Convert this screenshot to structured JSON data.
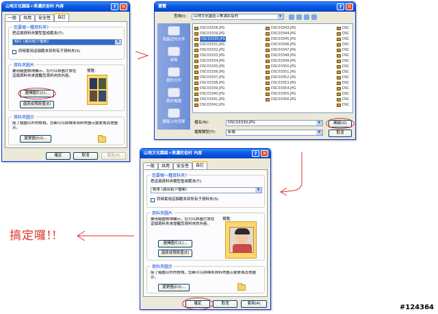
{
  "dialog1": {
    "title": "山地文化園區+美濃民俗村 內容",
    "tabs": [
      "一般",
      "共用",
      "安全性",
      "自訂"
    ],
    "group_type": {
      "title": "您要哪一種資料夾?",
      "label": "把這個資料夾類型當成範本(T):",
      "select_value": "相片 (適合較少檔案)",
      "checkbox_label": "同時套用這個範本到所有子資料夾(S)"
    },
    "group_pictures": {
      "title": "資料夾圖片",
      "desc": "要用縮圖檢視顯示，您可以將圖片放在這個資料夾來提醒您資料夾的內容。",
      "preview_label": "預覽:",
      "choose_button": "選擇圖片(C)...",
      "restore_button": "還原成預設值(E)"
    },
    "group_icons": {
      "title": "資料夾圖示",
      "desc": "除了縮圖以外的檢視，您都可以將標準資料夾圖示變更為其他圖示。",
      "change_button": "變更圖示(I)..."
    },
    "buttons": {
      "ok": "確定",
      "cancel": "取消",
      "apply": "套用(A)"
    }
  },
  "browse": {
    "title": "瀏覽",
    "lookin_label": "查詢(I):",
    "lookin_value": "山地文化園區+美濃民俗村",
    "places": [
      "我最近的文件",
      "桌面",
      "我的文件",
      "我的電腦",
      "網路上的芳鄰"
    ],
    "files_col1": [
      "DSC03328.JPG",
      "DSC03329.JPG",
      "DSC03330.JPG",
      "DSC03331.JPG",
      "DSC03332.JPG",
      "DSC03333.JPG",
      "DSC03334.JPG",
      "DSC03335.JPG",
      "DSC03336.JPG",
      "DSC03337.JPG",
      "DSC03338.JPG",
      "DSC03339.JPG",
      "DSC03340.JPG",
      "DSC03341.JPG",
      "DSC03342.JPG"
    ],
    "files_col2": [
      "DSC03343.JPG",
      "DSC03344.JPG",
      "DSC03345.JPG",
      "DSC03346.JPG",
      "DSC03347.JPG",
      "DSC03348.JPG",
      "DSC03349.JPG",
      "DSC03350.JPG",
      "DSC03351.JPG",
      "DSC03352.JPG",
      "DSC03353.JPG",
      "DSC03354.JPG",
      "DSC03355.JPG",
      "DSC03356.JPG"
    ],
    "files_col3": [
      "DSC",
      "DSC",
      "DSC",
      "DSC",
      "DSC",
      "DSC",
      "DSC",
      "DSC",
      "DSC",
      "DSC",
      "DSC",
      "DSC",
      "DSC",
      "DSC",
      "DSC"
    ],
    "filename_label": "檔名(N):",
    "filename_value": "DSC03330.JPG",
    "filetype_label": "檔案類型(T):",
    "filetype_value": "影像",
    "open_button": "開啟(O)",
    "cancel_button": "取消"
  },
  "dialog2": {
    "title": "山地文化園區+美濃民俗村 內容",
    "tabs": [
      "一般",
      "共用",
      "安全性",
      "自訂"
    ],
    "group_type": {
      "title": "您要哪一種資料夾?",
      "label": "把這個資料夾類型當成範本(T):",
      "select_value": "相本 (適合較少檔案)",
      "checkbox_label": "同時套用這個範本到所有子資料夾(S)"
    },
    "group_pictures": {
      "title": "資料夾圖片",
      "desc": "要用縮圖檢視顯示，您可以將圖片放在這個資料夾來提醒您資料夾的內容。",
      "preview_label": "預覽:",
      "choose_button": "選擇圖片(C)...",
      "restore_button": "還原成預設值(E)"
    },
    "group_icons": {
      "title": "資料夾圖示",
      "desc": "除了縮圖以外的檢視，您都可以將標準資料夾圖示變更為其他圖示。",
      "change_button": "變更圖示(I)..."
    },
    "buttons": {
      "ok": "確定",
      "cancel": "取消",
      "apply": "套用(A)"
    }
  },
  "annotation": {
    "done_text": "搞定囉!!",
    "watermark": "#124364"
  },
  "colors": {
    "xp_blue": "#0a5ce6",
    "annotation_red": "#e0312b",
    "dialog_bg": "#ece9d8"
  }
}
